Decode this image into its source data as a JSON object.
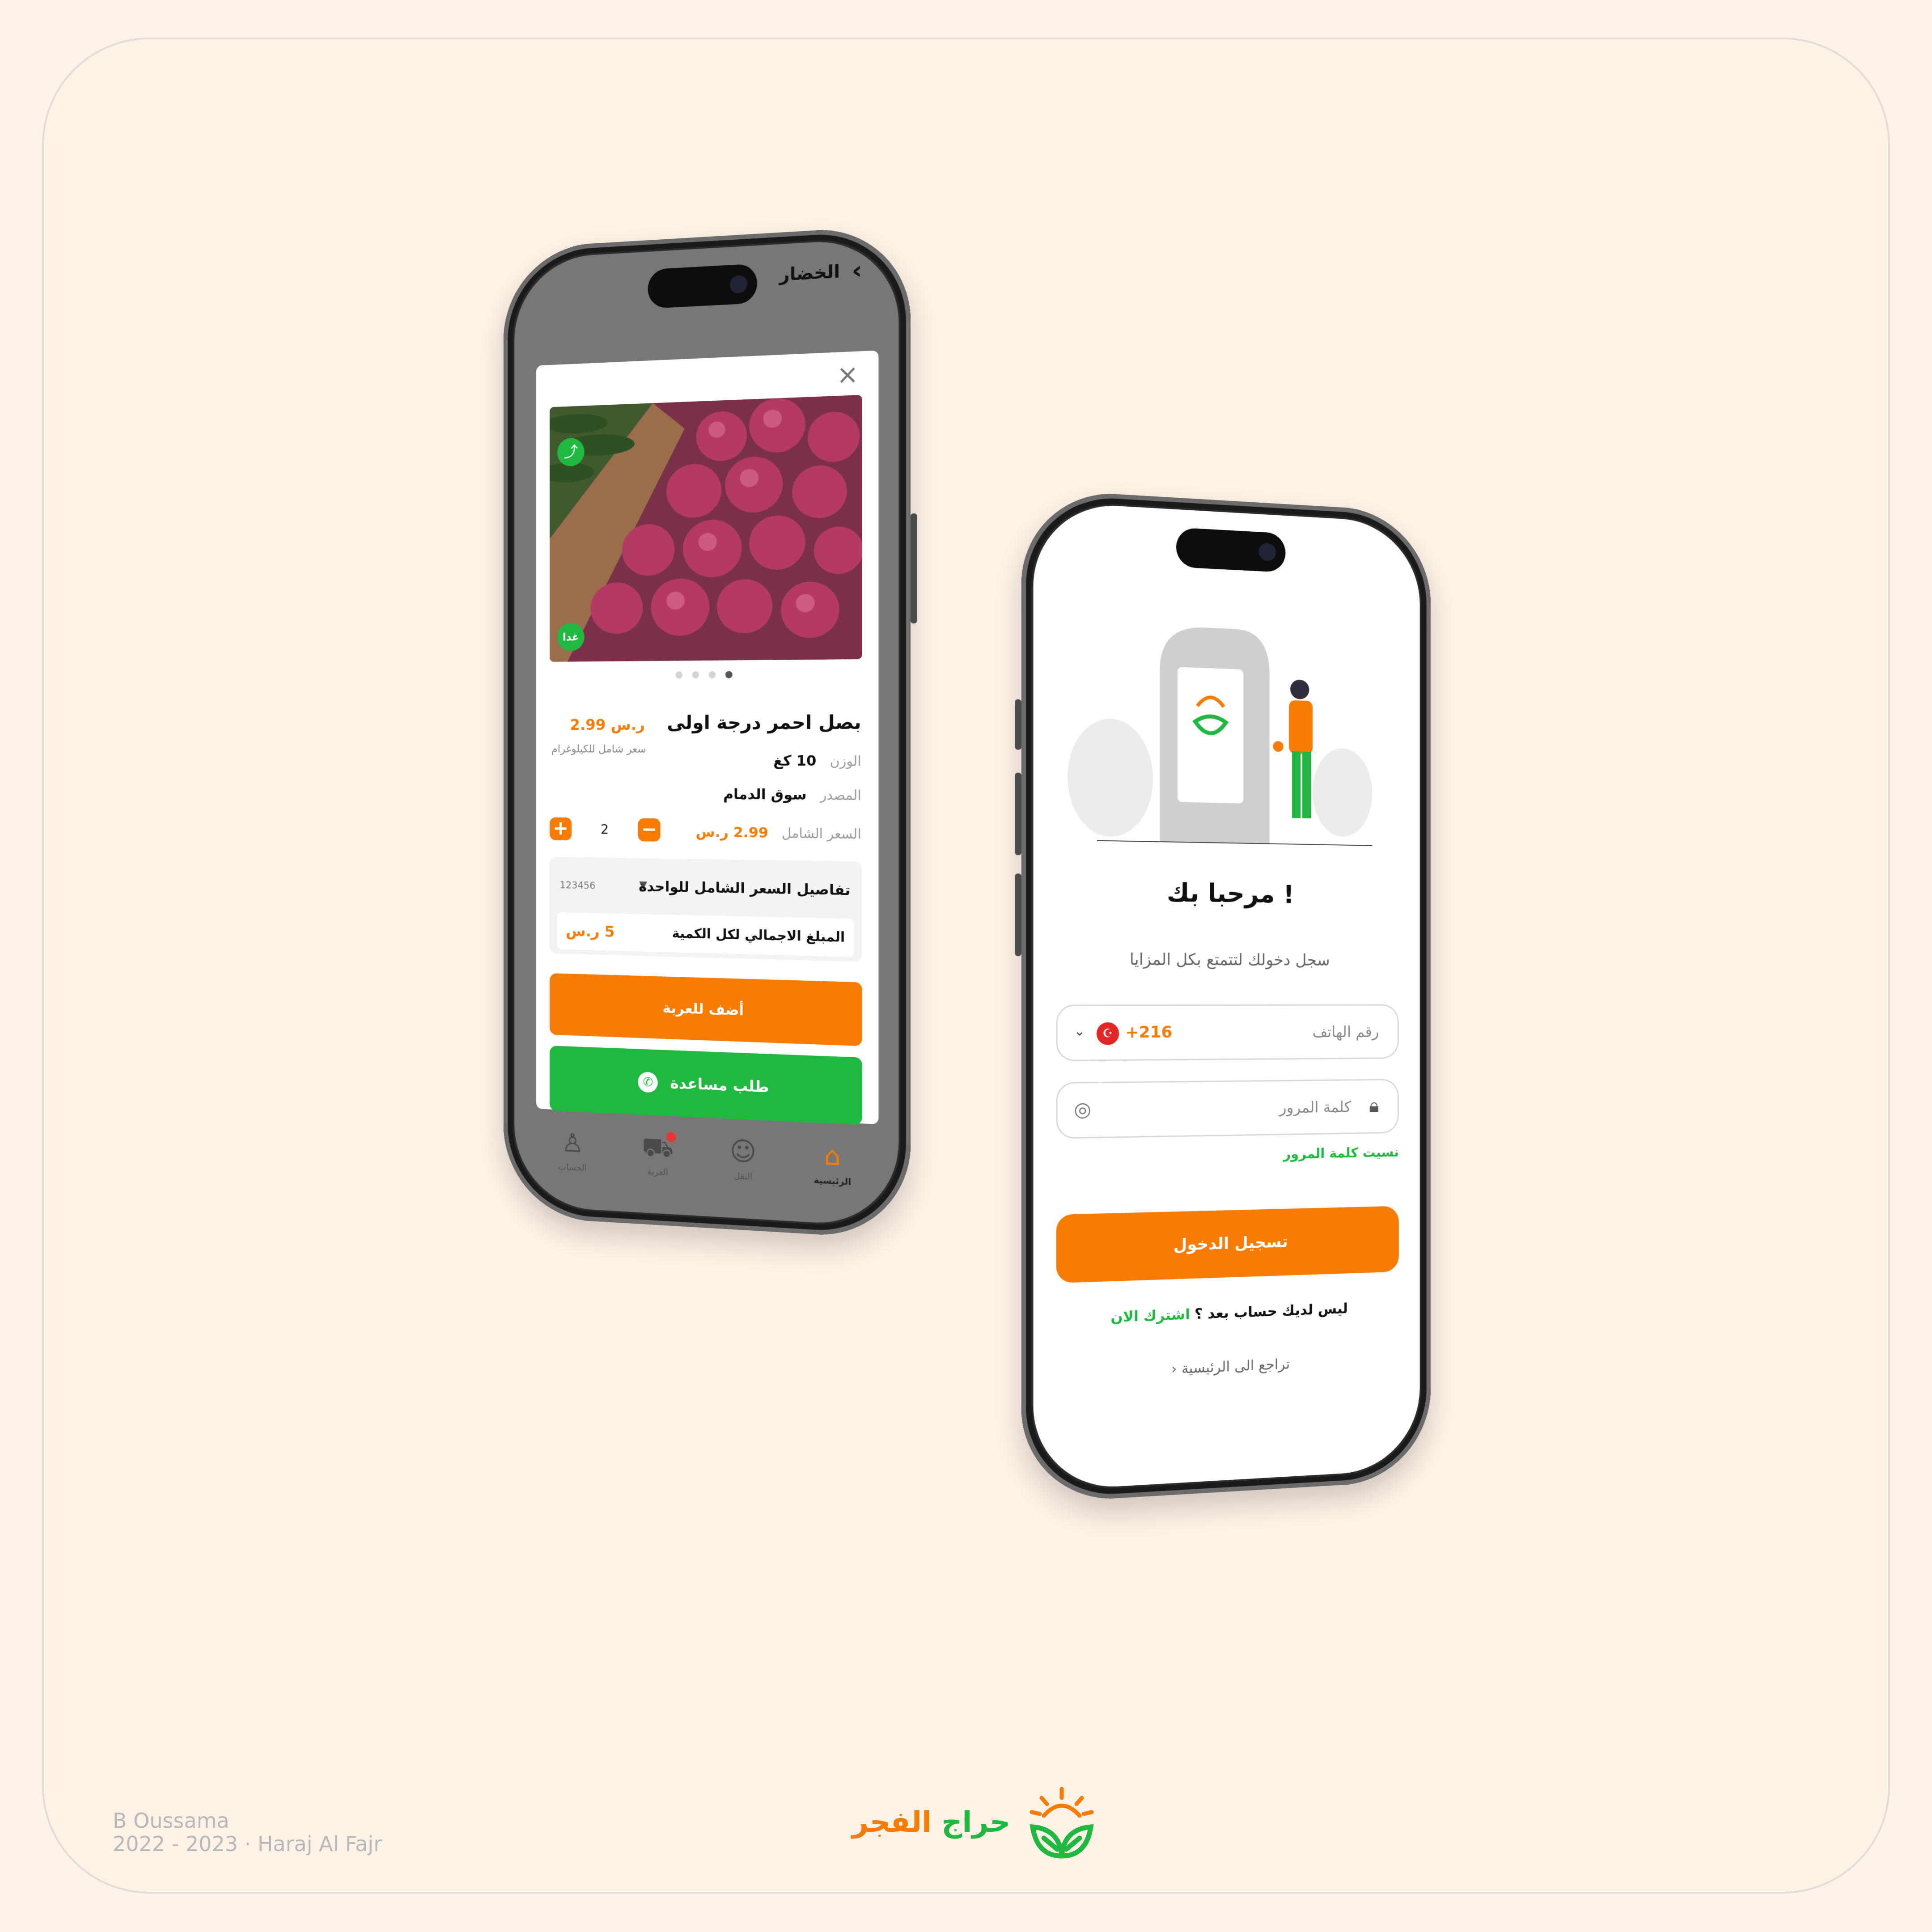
{
  "left_phone": {
    "header_title": "الخضار",
    "product": {
      "title": "بصل احمر درجة اولى",
      "price": "2.99 ر.س",
      "price_note": "سعر شامل للكيلوغرام",
      "tomorrow_badge": "غدا",
      "weight_label": "الوزن",
      "weight_value": "10 كغ",
      "source_label": "المصدر",
      "source_value": "سوق الدمام",
      "total_price_label": "السعر الشامل",
      "total_price_value": "2.99 ر.س",
      "quantity": "2",
      "details_title": "تفاصيل السعر الشامل للواحدة",
      "details_code": "123456",
      "grand_total_label": "المبلغ الاجمالي لكل الكمية",
      "grand_total_value": "5 ر.س",
      "add_to_cart": "أضف للعربة",
      "request_help": "طلب مساعدة"
    },
    "tabs": [
      {
        "label": "الرئيسية",
        "icon": "home-icon"
      },
      {
        "label": "النقل",
        "icon": "delivery-icon"
      },
      {
        "label": "العربة",
        "icon": "cart-icon"
      },
      {
        "label": "الحساب",
        "icon": "user-icon"
      }
    ]
  },
  "right_phone": {
    "welcome": "مرحبا بك !",
    "subtitle": "سجل دخولك لتتمتع بكل المزايا",
    "phone_placeholder": "رقم الهاتف",
    "country_code": "+216",
    "password_placeholder": "كلمة المرور",
    "forgot_password": "نسيت كلمة المرور",
    "login_button": "تسجيل الدخول",
    "no_account": "ليس لديك حساب بعد ؟",
    "subscribe_now": "اشترك الان",
    "back_home": "تراجع الى الرئيسية"
  },
  "footer": {
    "author": "B Oussama",
    "project": "2022 - 2023 · Haraj Al Fajr",
    "brand_name_green": "حراج",
    "brand_name_orange": "الفجر"
  },
  "colors": {
    "orange": "#f77c05",
    "green": "#1fb840",
    "background": "#fdf3e9"
  }
}
